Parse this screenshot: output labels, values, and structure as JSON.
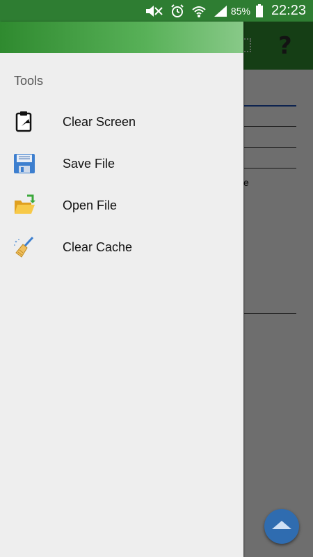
{
  "status_bar": {
    "battery_percent": "85%",
    "time": "22:23"
  },
  "drawer": {
    "section_title": "Tools",
    "items": [
      {
        "label": "Clear Screen",
        "icon": "clipboard-clear-icon"
      },
      {
        "label": "Save File",
        "icon": "floppy-disk-icon"
      },
      {
        "label": "Open File",
        "icon": "open-folder-icon"
      },
      {
        "label": "Clear Cache",
        "icon": "broom-icon"
      }
    ]
  },
  "background": {
    "help_symbol": "?",
    "partial_text": "e"
  },
  "colors": {
    "status_bar": "#2e7d32",
    "toolbar": "#2f8a2f",
    "fab": "#2f6cb0",
    "drawer_bg": "#eeeeee"
  }
}
